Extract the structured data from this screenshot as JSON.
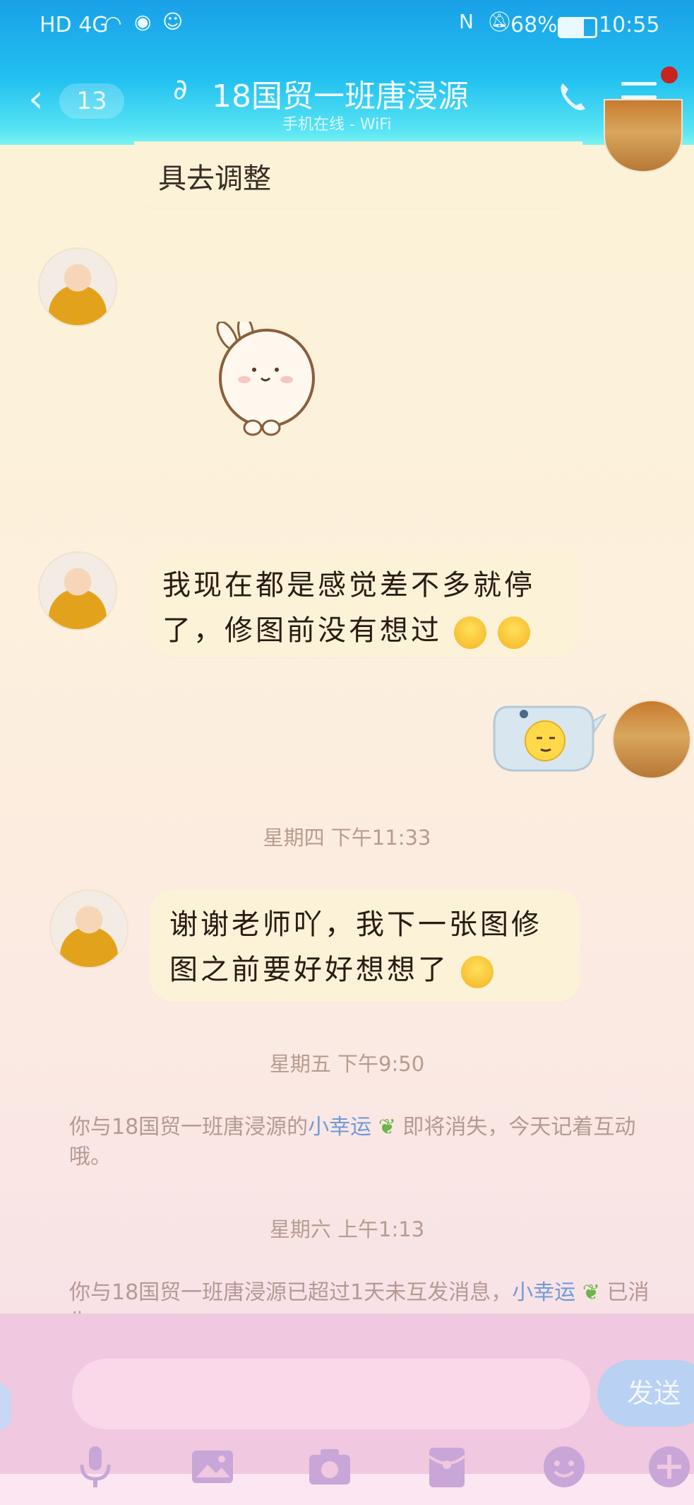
{
  "status_bar": {
    "network": "HD 4G",
    "battery": "68%",
    "time": "10:55"
  },
  "header": {
    "unread_count": "13",
    "title": "18国贸一班唐浸源",
    "subtitle": "手机在线 - WiFi"
  },
  "messages": {
    "partial_bubble_text": "具去调整",
    "partner_msg_1": "我现在都是感觉差不多就停了，修图前没有想过",
    "timestamp_1": "星期四 下午11:33",
    "partner_msg_2": "谢谢老师吖，我下一张图修图之前要好好想想了",
    "timestamp_2": "星期五 下午9:50",
    "system_1_prefix": "你与18国贸一班唐浸源的",
    "system_1_link": "小幸运",
    "system_1_suffix": "即将消失，今天记着互动哦。",
    "timestamp_3": "星期六 上午1:13",
    "system_2_prefix": "你与18国贸一班唐浸源已超过1天未互发消息，",
    "system_2_link": "小幸运",
    "system_2_suffix": "已消失。"
  },
  "input": {
    "placeholder": "",
    "send_label": "发送"
  },
  "toolbar": {
    "icons": [
      "microphone-icon",
      "image-icon",
      "camera-icon",
      "red-packet-icon",
      "emoji-icon",
      "plus-icon"
    ]
  },
  "colors": {
    "header_blue": "#1aa0e8",
    "link_blue": "#6f9bd8",
    "input_panel_pink": "#f0c8df"
  }
}
